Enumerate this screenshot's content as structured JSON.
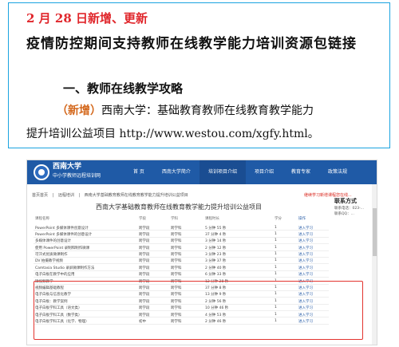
{
  "document": {
    "date_line": "2 月 28 日新增、更新",
    "title": "疫情防控期间支持教师在线教学能力培训资源包链接",
    "section": "一、教师在线教学攻略",
    "new_tag": "（新增）",
    "new_text": "西南大学：基础教育教师在线教育教学能力",
    "url_line": "提升培训公益项目 http://www.westou.com/xgfy.html。"
  },
  "site": {
    "brand_name": "西南大学",
    "brand_sub": "中小学教师远程培训网",
    "nav": [
      "首 页",
      "西南大学简介",
      "培训项目介绍",
      "项目介绍",
      "教育专家",
      "政策法规"
    ],
    "breadcrumb": [
      "首页首页",
      "|",
      "远程培训",
      "|",
      "西南大学基础教育教师在线教育教学能力提升培训公益项目"
    ],
    "side_note": "继续学习新增课程您在线...",
    "contact_title": "联系方式",
    "contact_rows": [
      "联系电话：023-...",
      "联系QQ：..."
    ],
    "course_title": "西南大学基础教育教师在线教育教学能力提升培训公益项目",
    "columns": [
      "课程名称",
      "学段",
      "学科",
      "课程时长",
      "学分",
      "操作"
    ],
    "rows": [
      [
        "PowerPoint 多媒体课件创意设计",
        "跨学段",
        "跨学科",
        "5 分钟 55 秒",
        "1",
        "进入学习"
      ],
      [
        "PowerPoint 多媒体课件的创意设计",
        "跨学段",
        "跨学科",
        "37 分钟 4 秒",
        "1",
        "进入学习"
      ],
      [
        "多媒体课件的创意设计",
        "跨学段",
        "跨学科",
        "3 分钟 14 秒",
        "1",
        "进入学习"
      ],
      [
        "使用 PowerPoint 录制和制作微课",
        "跨学段",
        "跨学科",
        "2 分钟 12 秒",
        "1",
        "进入学习"
      ],
      [
        "可汗式优质微课制作",
        "跨学段",
        "跨学科",
        "3 分钟 23 秒",
        "1",
        "进入学习"
      ],
      [
        "DV 拍摄教学视频",
        "跨学段",
        "跨学科",
        "3 分钟 37 秒",
        "1",
        "进入学习"
      ],
      [
        "Camtasia Studio 录屏微课制作方法",
        "跨学段",
        "跨学科",
        "2 分钟 40 秒",
        "1",
        "进入学习"
      ],
      [
        "电子白板在教学中的应用",
        "跨学段",
        "跨学科",
        "6 分钟 33 秒",
        "1",
        "进入学习"
      ],
      [
        "微视频教学",
        "跨学段",
        "跨学科",
        "12 分钟 28 秒",
        "1",
        "进入学习"
      ],
      [
        "视频编辑基础教程",
        "跨学段",
        "跨学科",
        "37 分钟 8 秒",
        "1",
        "进入学习"
      ],
      [
        "电子白板与信息化教学",
        "跨学段",
        "跨学科",
        "13 分钟 9 秒",
        "1",
        "进入学习"
      ],
      [
        "电子白板：教学案例",
        "跨学段",
        "跨学科",
        "2 分钟 56 秒",
        "1",
        "进入学习"
      ],
      [
        "电子白板学科工具（语文类）",
        "跨学段",
        "跨学科",
        "10 分钟 46 秒",
        "1",
        "进入学习"
      ],
      [
        "电子白板学科工具（数学类）",
        "跨学段",
        "跨学科",
        "4 分钟 53 秒",
        "1",
        "进入学习"
      ],
      [
        "电子白板学科工具（化学、物理）",
        "初中",
        "跨学科",
        "2 分钟 46 秒",
        "1",
        "进入学习"
      ]
    ],
    "highlight_color": "#e3342f"
  }
}
